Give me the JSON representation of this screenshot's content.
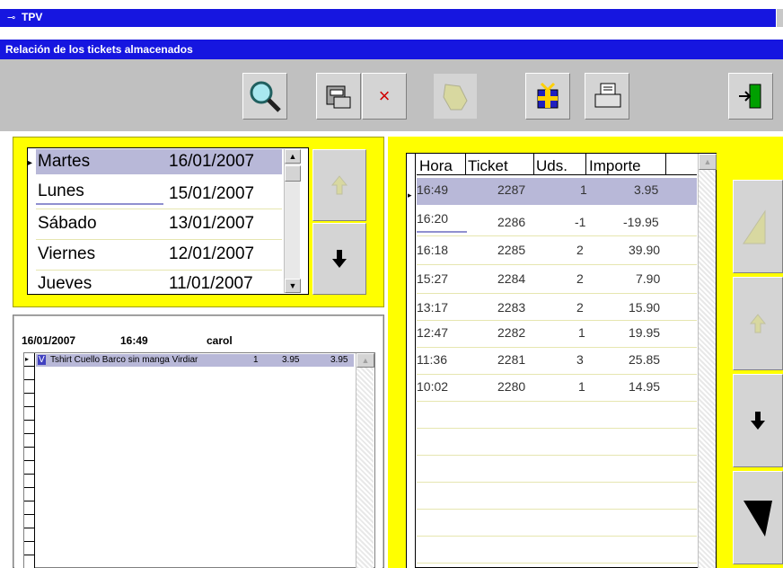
{
  "window": {
    "title": "TPV",
    "subtitle": "Relación de los tickets almacenados"
  },
  "toolbar": {
    "buttons": [
      {
        "name": "search-button",
        "icon": "magnifier-icon"
      },
      {
        "name": "cash-register-button",
        "icon": "cash-register-icon"
      },
      {
        "name": "delete-button",
        "icon": "x-icon",
        "glyph": "×"
      },
      {
        "name": "hand-button",
        "icon": "hand-icon"
      },
      {
        "name": "gift-button",
        "icon": "gift-icon"
      },
      {
        "name": "print-button",
        "icon": "printer-icon"
      },
      {
        "name": "exit-button",
        "icon": "exit-door-icon"
      }
    ]
  },
  "days": [
    {
      "day": "Martes",
      "date": "16/01/2007",
      "selected": true
    },
    {
      "day": "Lunes",
      "date": "15/01/2007"
    },
    {
      "day": "Sábado",
      "date": "13/01/2007"
    },
    {
      "day": "Viernes",
      "date": "12/01/2007"
    },
    {
      "day": "Jueves",
      "date": "11/01/2007"
    }
  ],
  "detail": {
    "date": "16/01/2007",
    "time": "16:49",
    "user": "carol",
    "lines": [
      {
        "flag": "V",
        "desc": "Tshirt Cuello Barco sin manga Virdiar",
        "qty": "1",
        "price": "3.95",
        "total": "3.95"
      }
    ]
  },
  "tickets": {
    "headers": {
      "hora": "Hora",
      "ticket": "Ticket",
      "uds": "Uds.",
      "importe": "Importe"
    },
    "rows": [
      {
        "hora": "16:49",
        "ticket": "2287",
        "uds": "1",
        "importe": "3.95",
        "selected": true
      },
      {
        "hora": "16:20",
        "ticket": "2286",
        "uds": "-1",
        "importe": "-19.95"
      },
      {
        "hora": "16:18",
        "ticket": "2285",
        "uds": "2",
        "importe": "39.90"
      },
      {
        "hora": "15:27",
        "ticket": "2284",
        "uds": "2",
        "importe": "7.90"
      },
      {
        "hora": "13:17",
        "ticket": "2283",
        "uds": "2",
        "importe": "15.90"
      },
      {
        "hora": "12:47",
        "ticket": "2282",
        "uds": "1",
        "importe": "19.95"
      },
      {
        "hora": "11:36",
        "ticket": "2281",
        "uds": "3",
        "importe": "25.85"
      },
      {
        "hora": "10:02",
        "ticket": "2280",
        "uds": "1",
        "importe": "14.95"
      }
    ]
  },
  "colors": {
    "titlebar": "#1616e0",
    "panel": "#ffff00",
    "face": "#c0c0c0",
    "selection": "#b8b8d8"
  }
}
